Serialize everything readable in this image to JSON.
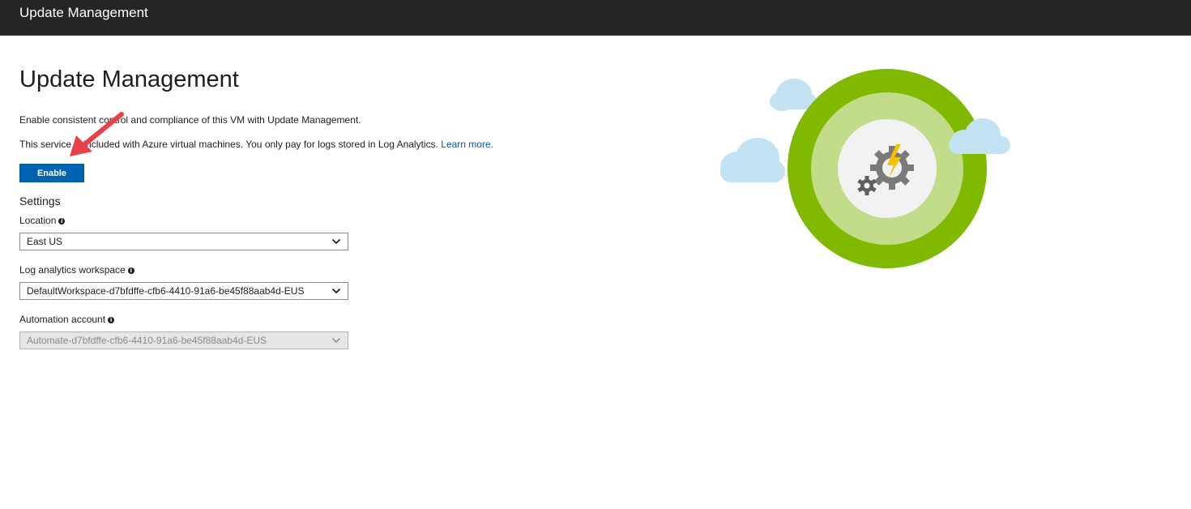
{
  "window": {
    "title": "Update Management"
  },
  "main": {
    "title": "Update Management",
    "description_line1": "Enable consistent control and compliance of this VM with Update Management.",
    "description_line2": "This service is included with Azure virtual machines. You only pay for logs stored in Log Analytics.",
    "learn_more_label": "Learn more.",
    "enable_button_label": "Enable"
  },
  "settings": {
    "heading": "Settings",
    "location": {
      "label": "Location",
      "value": "East US",
      "disabled": false
    },
    "workspace": {
      "label": "Log analytics workspace",
      "value": "DefaultWorkspace-d7bfdffe-cfb6-4410-91a6-be45f88aab4d-EUS",
      "disabled": false
    },
    "automation": {
      "label": "Automation account",
      "value": "Automate-d7bfdffe-cfb6-4410-91a6-be45f88aab4d-EUS",
      "disabled": true
    }
  },
  "icons": {
    "info": "info-icon",
    "dropdown": "chevron-down-icon",
    "illustration": "update-management-illustration",
    "annotation": "red-arrow-icon"
  },
  "colors": {
    "topbar_bg": "#252525",
    "accent_blue": "#0063b1",
    "link_blue": "#0058ad",
    "ring_outer": "#7fba00",
    "ring_inner": "#c2dc8a",
    "cloud": "#c3e2f2",
    "bolt": "#f8c100",
    "arrow_red": "#e8414b"
  }
}
